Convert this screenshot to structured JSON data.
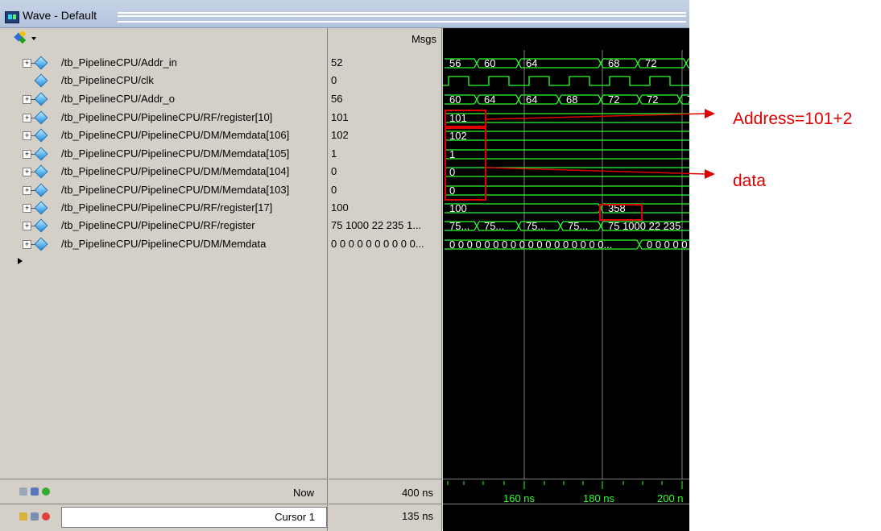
{
  "window": {
    "title": "Wave - Default"
  },
  "header": {
    "msgs_label": "Msgs"
  },
  "signals": [
    {
      "name": "/tb_PipelineCPU/Addr_in",
      "msg": "52",
      "expandable": true
    },
    {
      "name": "/tb_PipelineCPU/clk",
      "msg": "0",
      "expandable": false
    },
    {
      "name": "/tb_PipelineCPU/Addr_o",
      "msg": "56",
      "expandable": true
    },
    {
      "name": "/tb_PipelineCPU/PipelineCPU/RF/register[10]",
      "msg": "101",
      "expandable": true
    },
    {
      "name": "/tb_PipelineCPU/PipelineCPU/DM/Memdata[106]",
      "msg": "102",
      "expandable": true
    },
    {
      "name": "/tb_PipelineCPU/PipelineCPU/DM/Memdata[105]",
      "msg": "1",
      "expandable": true
    },
    {
      "name": "/tb_PipelineCPU/PipelineCPU/DM/Memdata[104]",
      "msg": "0",
      "expandable": true
    },
    {
      "name": "/tb_PipelineCPU/PipelineCPU/DM/Memdata[103]",
      "msg": "0",
      "expandable": true
    },
    {
      "name": "/tb_PipelineCPU/PipelineCPU/RF/register[17]",
      "msg": "100",
      "expandable": true
    },
    {
      "name": "/tb_PipelineCPU/PipelineCPU/RF/register",
      "msg": "75 1000 22 235 1...",
      "expandable": true
    },
    {
      "name": "/tb_PipelineCPU/PipelineCPU/DM/Memdata",
      "msg": "0 0 0 0 0 0 0 0 0 0...",
      "expandable": true
    }
  ],
  "wave_labels": {
    "addr_in": [
      "56",
      "60",
      "64",
      "68",
      "72"
    ],
    "addr_o": [
      "60",
      "64",
      "64",
      "68",
      "72",
      "72",
      "7"
    ],
    "register10": "101",
    "memdata106": "102",
    "memdata105": "1",
    "memdata104": "0",
    "memdata103": "0",
    "register17": [
      "100",
      "358"
    ],
    "register": [
      "75...",
      "75...",
      "75...",
      "75...",
      "75 1000 22 235"
    ],
    "memdata": [
      "0 0 0 0 0 0 0 0 0 0 0 0 0 0 0 0 0 0...",
      "0 0 0 0 0"
    ]
  },
  "status": {
    "now_label": "Now",
    "now_value": "400 ns",
    "cursor_label": "Cursor 1",
    "cursor_value": "135 ns"
  },
  "timeline": {
    "ticks": [
      "160 ns",
      "180 ns",
      "200 n"
    ]
  },
  "annotations": {
    "address": "Address=101+2",
    "data": "data"
  },
  "colors": {
    "wave": "#2dff2d",
    "annotation": "#e00000",
    "background": "#d4d0c8"
  },
  "icons": {
    "title": "wave-window-icon",
    "toolbar": "zoom-palette-icon",
    "signal": "signal-diamond-icon",
    "bottom_now": [
      "add-icon",
      "window-icon",
      "plus-circle-icon"
    ],
    "bottom_cursor": [
      "lock-icon",
      "edit-icon",
      "remove-icon"
    ]
  }
}
